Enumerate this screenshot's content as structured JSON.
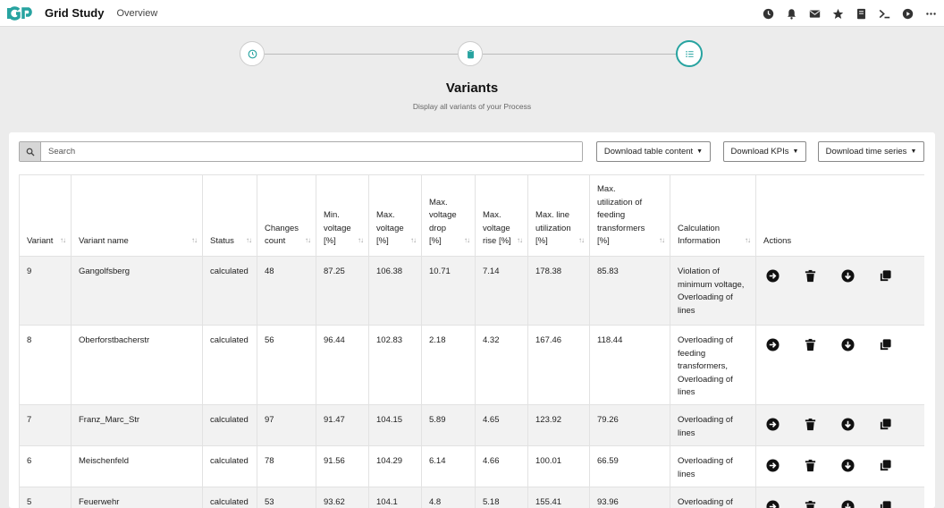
{
  "header": {
    "logo_text": "IGP",
    "app_title": "Grid Study",
    "nav_link": "Overview",
    "icons": [
      "clock-icon",
      "bell-icon",
      "mail-icon",
      "star-icon",
      "book-icon",
      "terminal-icon",
      "play-circle-icon",
      "more-icon"
    ]
  },
  "stepper": {
    "steps": [
      "clock-icon",
      "clipboard-icon",
      "list-icon"
    ],
    "active_step": 3,
    "title": "Variants",
    "subtitle": "Display all variants of your Process"
  },
  "toolbar": {
    "search_placeholder": "Search",
    "download_table": "Download table content",
    "download_kpis": "Download KPIs",
    "download_timeseries": "Download time series"
  },
  "table": {
    "columns": [
      "Variant",
      "Variant name",
      "Status",
      "Changes count",
      "Min. voltage [%]",
      "Max. voltage [%]",
      "Max. voltage drop [%]",
      "Max. voltage rise [%]",
      "Max. line utilization [%]",
      "Max. utilization of feeding transformers [%]",
      "Calculation Information",
      "Actions"
    ],
    "rows": [
      {
        "variant": "9",
        "name": "Gangolfsberg",
        "status": "calculated",
        "changes": "48",
        "min_v": "87.25",
        "max_v": "106.38",
        "drop": "10.71",
        "rise": "7.14",
        "line_util": "178.38",
        "trafo_util": "85.83",
        "info": "Violation of minimum voltage, Overloading of lines"
      },
      {
        "variant": "8",
        "name": "Oberforstbacherstr",
        "status": "calculated",
        "changes": "56",
        "min_v": "96.44",
        "max_v": "102.83",
        "drop": "2.18",
        "rise": "4.32",
        "line_util": "167.46",
        "trafo_util": "118.44",
        "info": "Overloading of feeding transformers, Overloading of lines"
      },
      {
        "variant": "7",
        "name": "Franz_Marc_Str",
        "status": "calculated",
        "changes": "97",
        "min_v": "91.47",
        "max_v": "104.15",
        "drop": "5.89",
        "rise": "4.65",
        "line_util": "123.92",
        "trafo_util": "79.26",
        "info": "Overloading of lines"
      },
      {
        "variant": "6",
        "name": "Meischenfeld",
        "status": "calculated",
        "changes": "78",
        "min_v": "91.56",
        "max_v": "104.29",
        "drop": "6.14",
        "rise": "4.66",
        "line_util": "100.01",
        "trafo_util": "66.59",
        "info": "Overloading of lines"
      },
      {
        "variant": "5",
        "name": "Feuerwehr",
        "status": "calculated",
        "changes": "53",
        "min_v": "93.62",
        "max_v": "104.1",
        "drop": "4.8",
        "rise": "5.18",
        "line_util": "155.41",
        "trafo_util": "93.96",
        "info": "Overloading of"
      }
    ],
    "row_actions": [
      "arrow-right-circle-icon",
      "trash-icon",
      "download-circle-icon",
      "copy-icon"
    ]
  },
  "colors": {
    "accent": "#27a3a0",
    "page_bg": "#ececec",
    "row_alt": "#f2f2f2"
  }
}
